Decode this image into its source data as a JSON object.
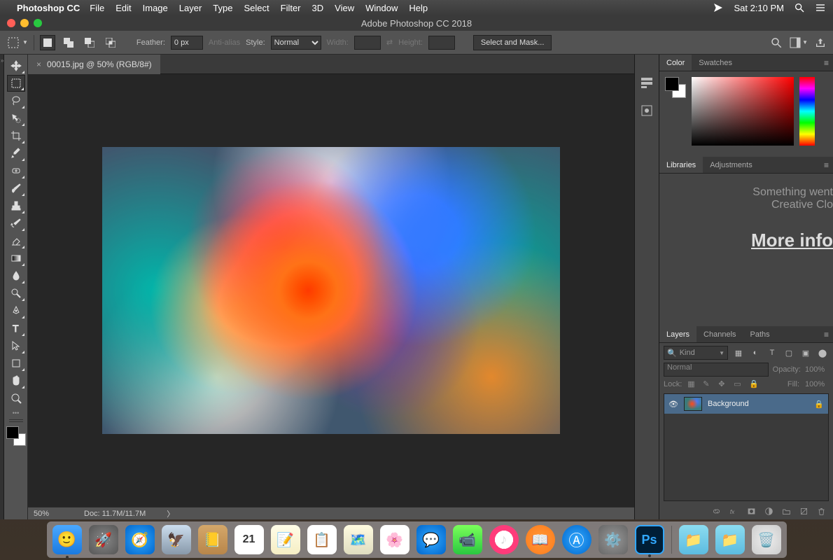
{
  "mac_menubar": {
    "app_name": "Photoshop CC",
    "menus": [
      "File",
      "Edit",
      "Image",
      "Layer",
      "Type",
      "Select",
      "Filter",
      "3D",
      "View",
      "Window",
      "Help"
    ],
    "clock": "Sat 2:10 PM"
  },
  "window": {
    "title": "Adobe Photoshop CC 2018"
  },
  "options_bar": {
    "feather_label": "Feather:",
    "feather_value": "0 px",
    "antialias_label": "Anti-alias",
    "style_label": "Style:",
    "style_value": "Normal",
    "width_label": "Width:",
    "width_value": "",
    "height_label": "Height:",
    "height_value": "",
    "select_mask": "Select and Mask..."
  },
  "document": {
    "tab_title": "00015.jpg @ 50% (RGB/8#)",
    "zoom": "50%",
    "doc_size": "Doc: 11.7M/11.7M"
  },
  "panels": {
    "color_tabs": [
      "Color",
      "Swatches"
    ],
    "lib_tabs": [
      "Libraries",
      "Adjustments"
    ],
    "lib_message_l1": "Something went",
    "lib_message_l2": "Creative Clo",
    "lib_more": "More info",
    "layers_tabs": [
      "Layers",
      "Channels",
      "Paths"
    ],
    "layers": {
      "kind_label": "Kind",
      "blend_mode": "Normal",
      "opacity_label": "Opacity:",
      "opacity_value": "100%",
      "lock_label": "Lock:",
      "fill_label": "Fill:",
      "fill_value": "100%",
      "layer_0": {
        "name": "Background"
      }
    }
  },
  "dock": {
    "cal_day": "21",
    "ps_label": "Ps"
  }
}
